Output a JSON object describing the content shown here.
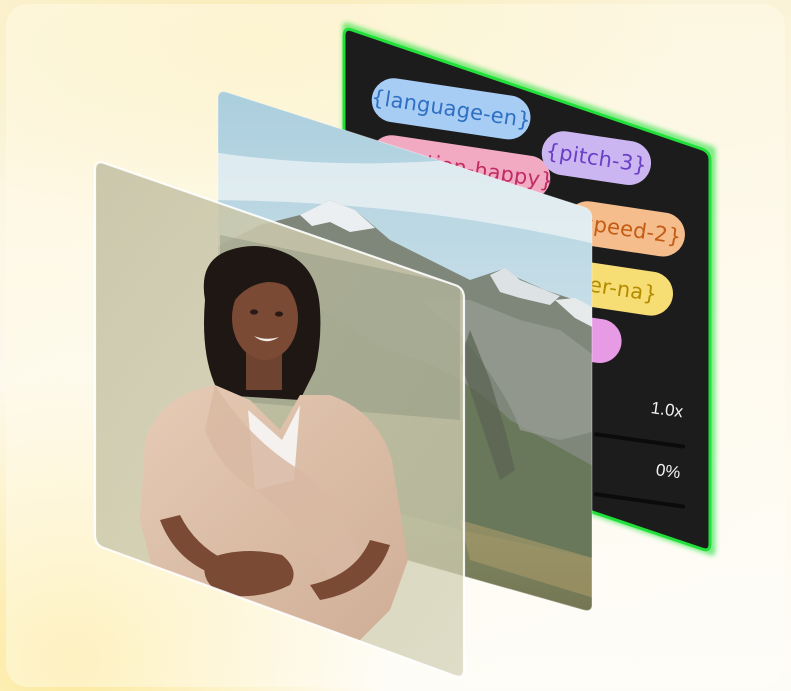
{
  "tags": {
    "language": "{language-en}",
    "pitch": "{pitch-3}",
    "emotion": "{emotion-happy}",
    "speed": "{speed-2}",
    "filter": "ter-na}"
  },
  "controls": {
    "speed_value": "1.0x",
    "volume_value": "0%"
  },
  "colors": {
    "panel_border": "#22e03a",
    "panel_bg": "#1c1c1c",
    "pill_language": "#a7cdf4",
    "pill_pitch": "#cbb6f1",
    "pill_emotion": "#f2aac3",
    "pill_speed": "#f5bc8c",
    "pill_filter": "#f6dd74",
    "pill_teal": "#8fe0cf",
    "pill_magenta": "#e79be4"
  }
}
